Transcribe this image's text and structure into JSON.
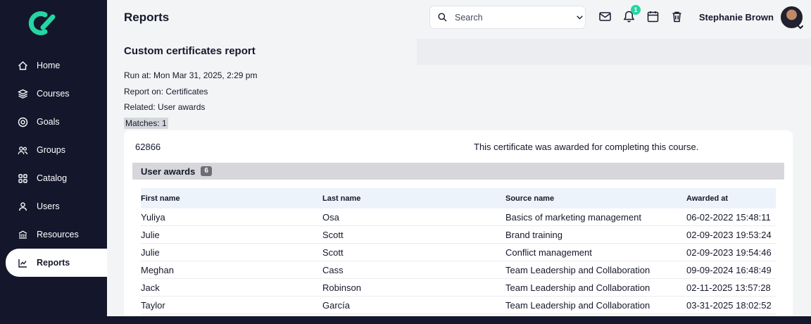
{
  "colors": {
    "accent": "#24d6a3",
    "sidebar_bg": "#14162b",
    "table_header_bg": "#edf3fa"
  },
  "sidebar": {
    "items": [
      {
        "label": "Home",
        "icon": "home",
        "active": false
      },
      {
        "label": "Courses",
        "icon": "courses",
        "active": false
      },
      {
        "label": "Goals",
        "icon": "goals",
        "active": false
      },
      {
        "label": "Groups",
        "icon": "groups",
        "active": false
      },
      {
        "label": "Catalog",
        "icon": "catalog",
        "active": false
      },
      {
        "label": "Users",
        "icon": "users",
        "active": false
      },
      {
        "label": "Resources",
        "icon": "resources",
        "active": false
      },
      {
        "label": "Reports",
        "icon": "reports",
        "active": true
      }
    ]
  },
  "header": {
    "title": "Reports",
    "search_placeholder": "Search",
    "notification_count": "1",
    "icons": [
      "search-icon",
      "chevron-down-icon",
      "mail-icon",
      "bell-icon",
      "calendar-icon",
      "trash-icon"
    ],
    "user_name": "Stephanie Brown"
  },
  "report": {
    "title": "Custom certificates report",
    "run_at": "Run at: Mon Mar 31, 2025, 2:29 pm",
    "report_on": "Report on: Certificates",
    "related": "Related: User awards",
    "matches_label": "Matches: 1",
    "certificate_id": "62866",
    "certificate_description": "This certificate was awarded for completing this course.",
    "section_title": "User awards",
    "section_count": "6",
    "table": {
      "columns": [
        "First name",
        "Last name",
        "Source name",
        "Awarded at"
      ],
      "rows": [
        [
          "Yuliya",
          "Osa",
          "Basics of marketing management",
          "06-02-2022 15:48:11"
        ],
        [
          "Julie",
          "Scott",
          "Brand training",
          "02-09-2023 19:53:24"
        ],
        [
          "Julie",
          "Scott",
          "Conflict management",
          "02-09-2023 19:54:46"
        ],
        [
          "Meghan",
          "Cass",
          "Team Leadership and Collaboration",
          "09-09-2024 16:48:49"
        ],
        [
          "Jack",
          "Robinson",
          "Team Leadership and Collaboration",
          "02-11-2025 13:57:28"
        ],
        [
          "Taylor",
          "García",
          "Team Leadership and Collaboration",
          "03-31-2025 18:02:52"
        ]
      ]
    }
  }
}
